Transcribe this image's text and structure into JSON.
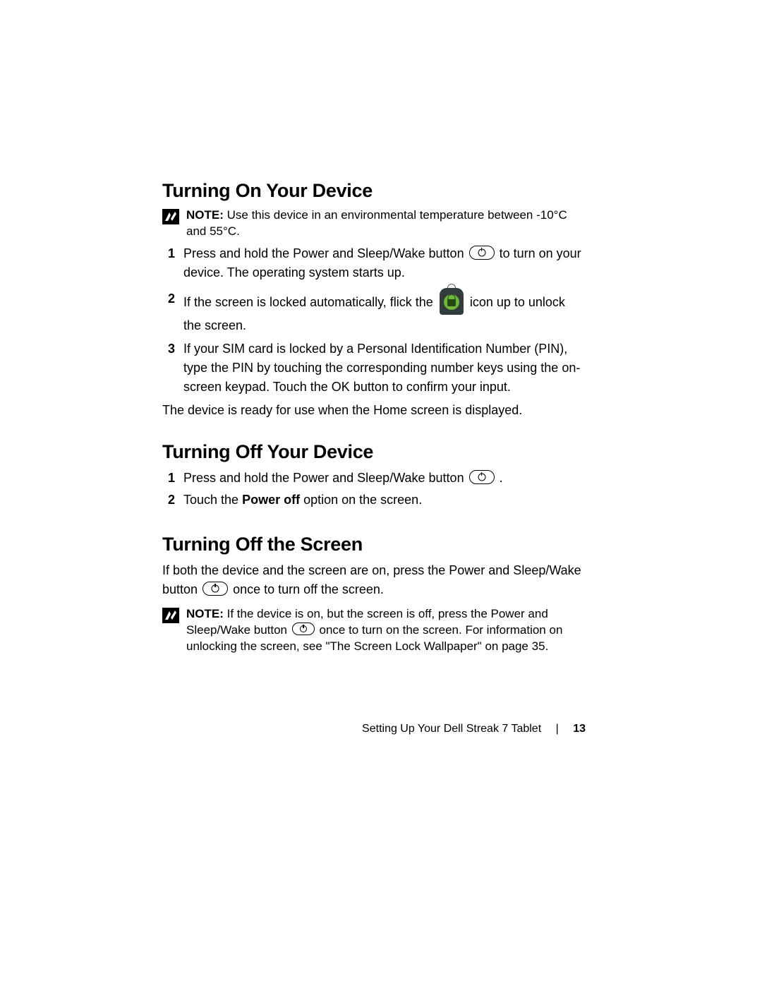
{
  "sections": {
    "on": {
      "heading": "Turning On Your Device",
      "note_label": "NOTE:",
      "note_text": " Use this device in an environmental temperature between -10°C and 55°C.",
      "step1_a": "Press and hold the Power and Sleep/Wake button ",
      "step1_b": " to turn on your device. The operating system starts up.",
      "step2_a": "If the screen is locked automatically, flick the ",
      "step2_b": " icon up to unlock the screen.",
      "step3": "If your SIM card is locked by a Personal Identification Number (PIN), type the PIN by touching the corresponding number keys using the on-screen keypad. Touch the OK button to confirm your input.",
      "closing": "The device is ready for use when the Home screen is displayed."
    },
    "off": {
      "heading": "Turning Off Your Device",
      "step1": "Press and hold the Power and Sleep/Wake button ",
      "step1_tail": " .",
      "step2_a": "Touch the ",
      "step2_bold": "Power off",
      "step2_b": " option on the screen."
    },
    "screen": {
      "heading": "Turning Off the Screen",
      "para_a": "If both the device and the screen are on, press the Power and Sleep/Wake button ",
      "para_b": " once to turn off the screen.",
      "note_label": "NOTE:",
      "note_a": " If the device is on, but the screen is off, press the Power and Sleep/Wake button ",
      "note_b": " once to turn on the screen. For information on unlocking the screen, see \"The Screen Lock Wallpaper\" on page 35."
    }
  },
  "nums": {
    "n1": "1",
    "n2": "2",
    "n3": "3"
  },
  "footer": {
    "chapter": "Setting Up Your Dell Streak 7 Tablet",
    "page": "13"
  }
}
